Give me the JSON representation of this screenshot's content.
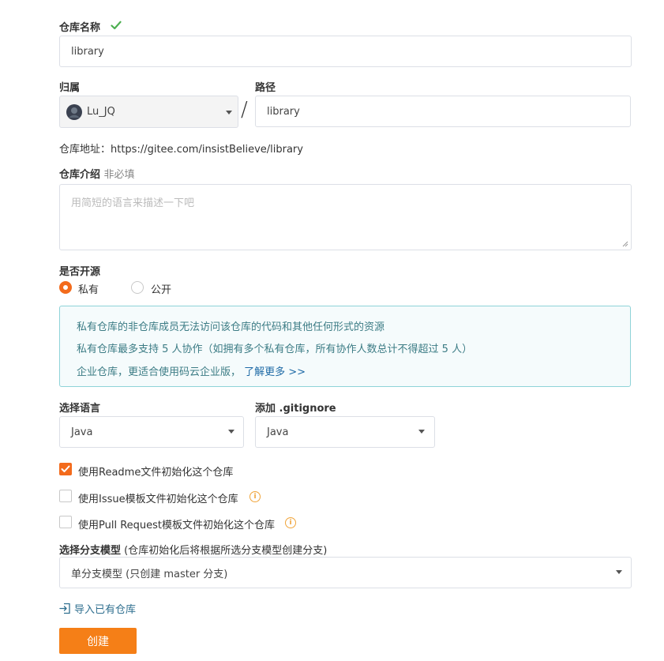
{
  "repo_name": {
    "label": "仓库名称",
    "value": "library"
  },
  "owner": {
    "label": "归属",
    "selected": "Lu_JQ"
  },
  "path": {
    "label": "路径",
    "separator": "/",
    "value": "library"
  },
  "repo_address": {
    "text": "仓库地址：https://gitee.com/insistBelieve/library"
  },
  "description": {
    "label": "仓库介绍",
    "optional_hint": "非必填",
    "placeholder": "用简短的语言来描述一下吧"
  },
  "visibility": {
    "label": "是否开源",
    "options": [
      {
        "label": "私有",
        "selected": true
      },
      {
        "label": "公开",
        "selected": false
      }
    ]
  },
  "notice": {
    "lines": [
      "私有仓库的非仓库成员无法访问该仓库的代码和其他任何形式的资源",
      "私有仓库最多支持 5 人协作（如拥有多个私有仓库，所有协作人数总计不得超过 5 人）"
    ],
    "enterprise_text": "企业仓库，更适合使用码云企业版，",
    "learn_more": "了解更多 >>"
  },
  "language": {
    "label": "选择语言",
    "selected": "Java"
  },
  "gitignore": {
    "label": "添加 .gitignore",
    "selected": "Java"
  },
  "init_options": [
    {
      "label": "使用Readme文件初始化这个仓库",
      "checked": true,
      "info": false
    },
    {
      "label": "使用Issue模板文件初始化这个仓库",
      "checked": false,
      "info": true
    },
    {
      "label": "使用Pull Request模板文件初始化这个仓库",
      "checked": false,
      "info": true
    }
  ],
  "branch_model": {
    "label": "选择分支模型",
    "hint": "(仓库初始化后将根据所选分支模型创建分支)",
    "selected": "单分支模型 (只创建 master 分支)"
  },
  "import_link": "导入已有仓库",
  "create_button": "创建",
  "colors": {
    "accent": "#f36b1c",
    "button": "#f57f17",
    "check": "#4caf50",
    "notice_border": "#8fd3d8",
    "notice_text": "#3c7c85"
  }
}
